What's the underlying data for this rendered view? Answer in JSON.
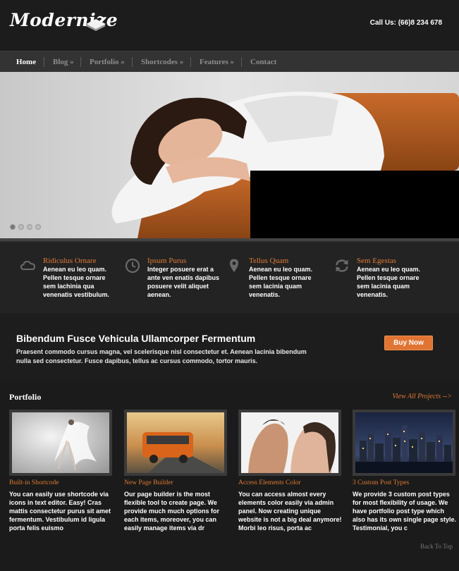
{
  "header": {
    "logo": "Modernize",
    "call_us": "Call Us: (66)8 234 678"
  },
  "nav": {
    "items": [
      {
        "label": "Home",
        "active": true
      },
      {
        "label": "Blog »"
      },
      {
        "label": "Portfolio »"
      },
      {
        "label": "Shortcodes »"
      },
      {
        "label": "Features »"
      },
      {
        "label": "Contact"
      }
    ]
  },
  "slider": {
    "slide_count": 4,
    "active_slide": 1
  },
  "features": [
    {
      "icon": "cloud-icon",
      "title": "Ridiculus Ornare",
      "text": "Aenean eu leo quam. Pellen tesque ornare sem lachinia qua venenatis vestibulum."
    },
    {
      "icon": "clock-icon",
      "title": "Ipsum Purus",
      "text": "Integer posuere erat a ante ven enatis dapibus posuere velit aliquet aenean."
    },
    {
      "icon": "map-pin-icon",
      "title": "Tellus Quam",
      "text": "Aenean eu leo quam. Pellen tesque ornare sem lacinia quam venenatis."
    },
    {
      "icon": "refresh-icon",
      "title": "Sem Egestas",
      "text": "Aenean eu leo quam. Pellen tesque ornare sem lacinia quam venenatis."
    }
  ],
  "cta": {
    "title": "Bibendum Fusce Vehicula Ullamcorper Fermentum",
    "text": "Praesent commodo cursus magna, vel scelerisque nisl consectetur et. Aenean lacinia bibendum nulla sed consectetur. Fusce dapibus, tellus ac cursus commodo, tortor mauris.",
    "button": "Buy Now"
  },
  "portfolio": {
    "heading": "Portfolio",
    "view_all": "View All Projects -->",
    "items": [
      {
        "title": "Built-in Shortcode",
        "text": "You can easily use shortcode via icons in text editor. Easy! Cras mattis consectetur purus sit amet fermentum. Vestibulum id ligula porta felis euismo"
      },
      {
        "title": "New Page Builder",
        "text": "Our page builder is the most flexible tool to create page. We provide much much options for each items, moreover, you can easily manage items via dr"
      },
      {
        "title": "Access Elements Color",
        "text": "You can access almost every elements color easily via admin panel. Now creating unique website is not a big deal anymore! Morbi leo risus, porta ac"
      },
      {
        "title": "3 Custom Post Types",
        "text": "We provide 3 custom post types for most flexibility of usage. We have portfolio post type which also has its own single page style. Testimonial, you c"
      }
    ],
    "back_to_top": "Back To Top"
  },
  "colors": {
    "accent": "#e07433",
    "background": "#1a1a1a",
    "nav_bar": "#333333"
  }
}
